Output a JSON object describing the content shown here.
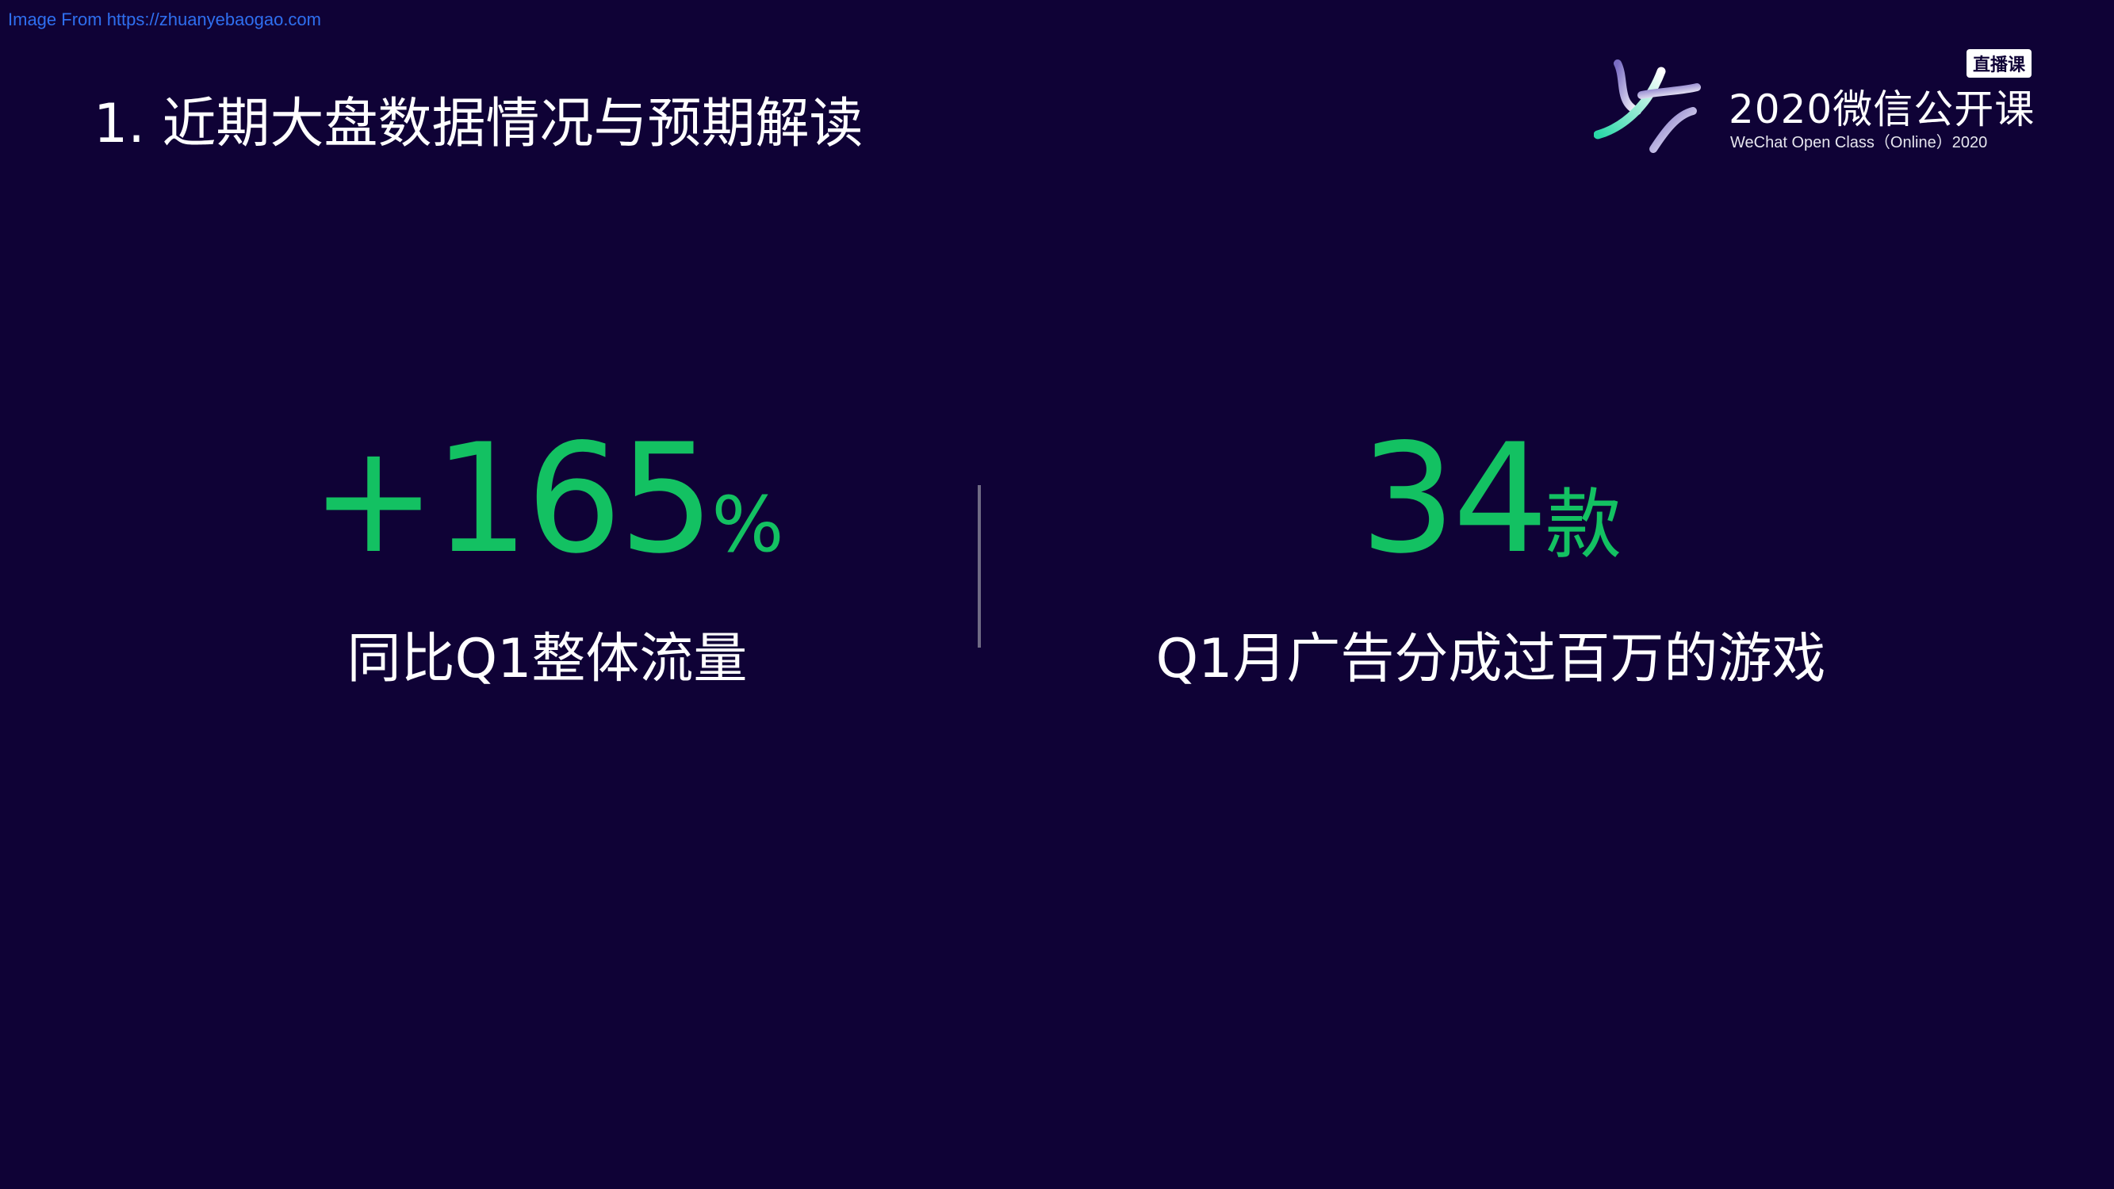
{
  "watermark": "Image From https://zhuanyebaogao.com",
  "slide_title": "1. 近期大盘数据情况与预期解读",
  "logo": {
    "badge": "直播课",
    "name": "2020微信公开课",
    "subtitle": "WeChat Open Class（Online）2020",
    "icon": "wechat-open-class-logo-icon"
  },
  "stats": [
    {
      "number": "+165",
      "unit": "%",
      "label": "同比Q1整体流量"
    },
    {
      "number": "34",
      "unit": "款",
      "label": "Q1月广告分成过百万的游戏"
    }
  ],
  "colors": {
    "background": "#0f0236",
    "accent_green": "#13c162",
    "text": "#ffffff",
    "divider": "#6f6a84"
  }
}
